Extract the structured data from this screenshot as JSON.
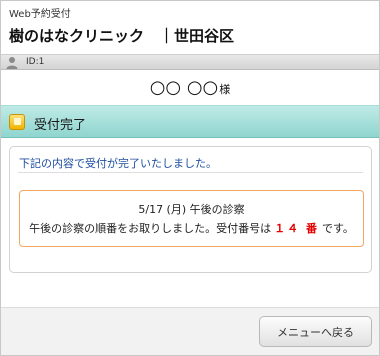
{
  "header": {
    "service_name": "Web予約受付",
    "clinic_name": "樹のはなクリニック　｜世田谷区"
  },
  "user_bar": {
    "icon": "user-icon",
    "id_text": "ID:1"
  },
  "patient": {
    "name": "○○ ○○",
    "suffix": "様"
  },
  "section": {
    "icon": "package-icon",
    "title": "受付完了"
  },
  "card": {
    "message": "下記の内容で受付が完了いたしました。",
    "date_line": "5/17 (月) 午後の診察",
    "order_text": "午後の診察の順番をお取りしました。受付番号は",
    "ticket_number": "１４",
    "ticket_unit": "番",
    "suffix_text": "です。"
  },
  "footer": {
    "menu_button_label": "メニューへ戻る"
  },
  "colors": {
    "section_bar": "#8fd5cf",
    "message_text": "#1f4fa0",
    "info_border": "#f0a860",
    "ticket_number": "#e60000"
  }
}
